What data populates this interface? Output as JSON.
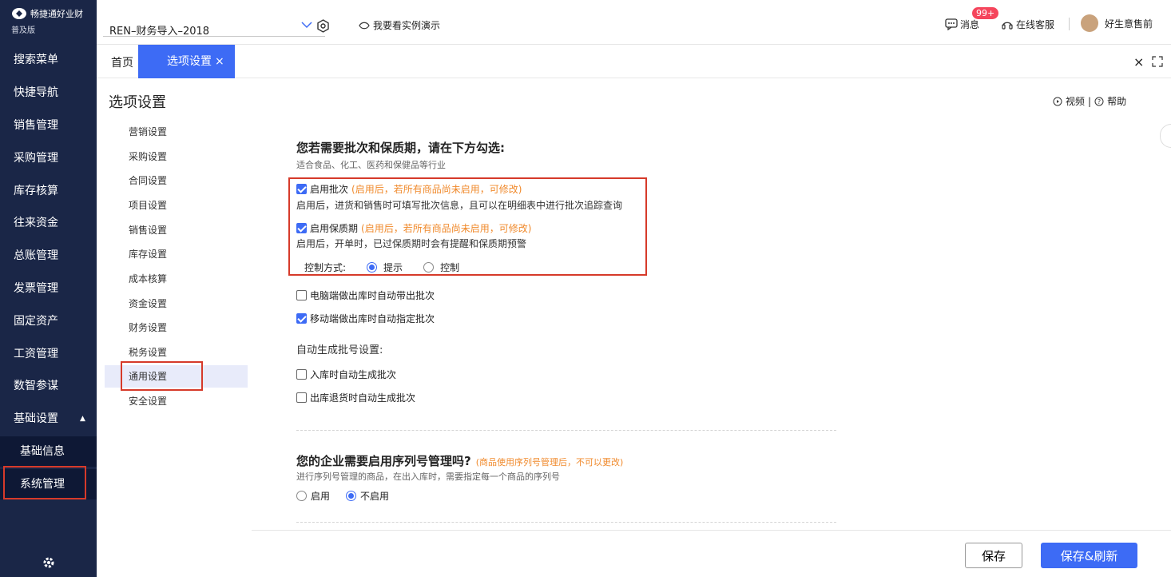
{
  "brand": {
    "name": "畅捷通好业财",
    "edition": "普及版"
  },
  "nav": {
    "items": [
      "搜索菜单",
      "快捷导航",
      "销售管理",
      "采购管理",
      "库存核算",
      "往来资金",
      "总账管理",
      "发票管理",
      "固定资产",
      "工资管理",
      "数智参谋",
      "基础设置"
    ],
    "sub_items": [
      "基础信息",
      "系统管理"
    ]
  },
  "topbar": {
    "account": "REN–财务导入–2018",
    "demo": "我要看实例演示",
    "messages": "消息",
    "badge": "99+",
    "service": "在线客服",
    "user": "好生意售前"
  },
  "tabs": {
    "home": "首页",
    "active": "选项设置"
  },
  "page": {
    "title": "选项设置",
    "video": "视频",
    "help": "帮助"
  },
  "menu": [
    "营销设置",
    "采购设置",
    "合同设置",
    "项目设置",
    "销售设置",
    "库存设置",
    "成本核算",
    "资金设置",
    "财务设置",
    "税务设置",
    "通用设置",
    "安全设置"
  ],
  "batch": {
    "heading": "您若需要批次和保质期，请在下方勾选:",
    "subheading": "适合食品、化工、医药和保健品等行业",
    "enable_batch": "启用批次",
    "enable_batch_note": "(启用后，若所有商品尚未启用，可修改)",
    "enable_batch_desc": "启用后，进货和销售时可填写批次信息，且可以在明细表中进行批次追踪查询",
    "enable_shelf": "启用保质期",
    "enable_shelf_note": "(启用后，若所有商品尚未启用，可修改)",
    "enable_shelf_desc": "启用后，开单时，已过保质期时会有提醒和保质期预警",
    "control_label": "控制方式:",
    "control_opt1": "提示",
    "control_opt2": "控制",
    "pc_auto": "电脑端做出库时自动带出批次",
    "mobile_auto": "移动端做出库时自动指定批次",
    "autogen_label": "自动生成批号设置:",
    "in_auto": "入库时自动生成批次",
    "out_return_auto": "出库退货时自动生成批次"
  },
  "serial": {
    "heading": "您的企业需要启用序列号管理吗?",
    "note": "(商品使用序列号管理后，不可以更改)",
    "desc": "进行序列号管理的商品，在出入库时，需要指定每一个商品的序列号",
    "opt_on": "启用",
    "opt_off": "不启用"
  },
  "footer": {
    "save": "保存",
    "save_refresh": "保存&刷新"
  },
  "colors": {
    "nav_bg": "#1a2647",
    "accent": "#3d6bf5",
    "warn": "#f08a2c",
    "highlight": "#d63a2a"
  }
}
